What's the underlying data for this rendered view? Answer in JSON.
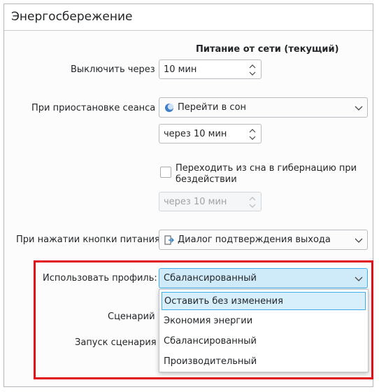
{
  "header": {
    "title": "Энергосбережение"
  },
  "column_header": "Питание от сети (текущий)",
  "rows": {
    "turn_off": {
      "label": "Выключить через",
      "value": "10 мин"
    },
    "suspend": {
      "label": "При приостановке сеанса",
      "value": "Перейти в сон",
      "icon": "moon-icon"
    },
    "suspend_delay": {
      "value": "через 10 мин"
    },
    "hibernate": {
      "label": "Переходить из сна в гибернацию при бездействии",
      "line1": "Переходить из сна в гибернацию при",
      "line2": "бездействии",
      "checked": false
    },
    "hibernate_delay": {
      "value": "через 10 мин"
    },
    "power_button": {
      "label": "При нажатии кнопки питания",
      "value": "Диалог подтверждения выхода",
      "icon": "logout-icon"
    },
    "profile": {
      "label": "Использовать профиль:",
      "value": "Сбалансированный"
    },
    "script": {
      "label": "Сценарий"
    },
    "script_run": {
      "label": "Запуск сценария"
    }
  },
  "profile_options": [
    "Оставить без изменения",
    "Экономия энергии",
    "Сбалансированный",
    "Производительный"
  ],
  "colors": {
    "accent": "#3daee9",
    "highlight_box": "#e10d16"
  }
}
